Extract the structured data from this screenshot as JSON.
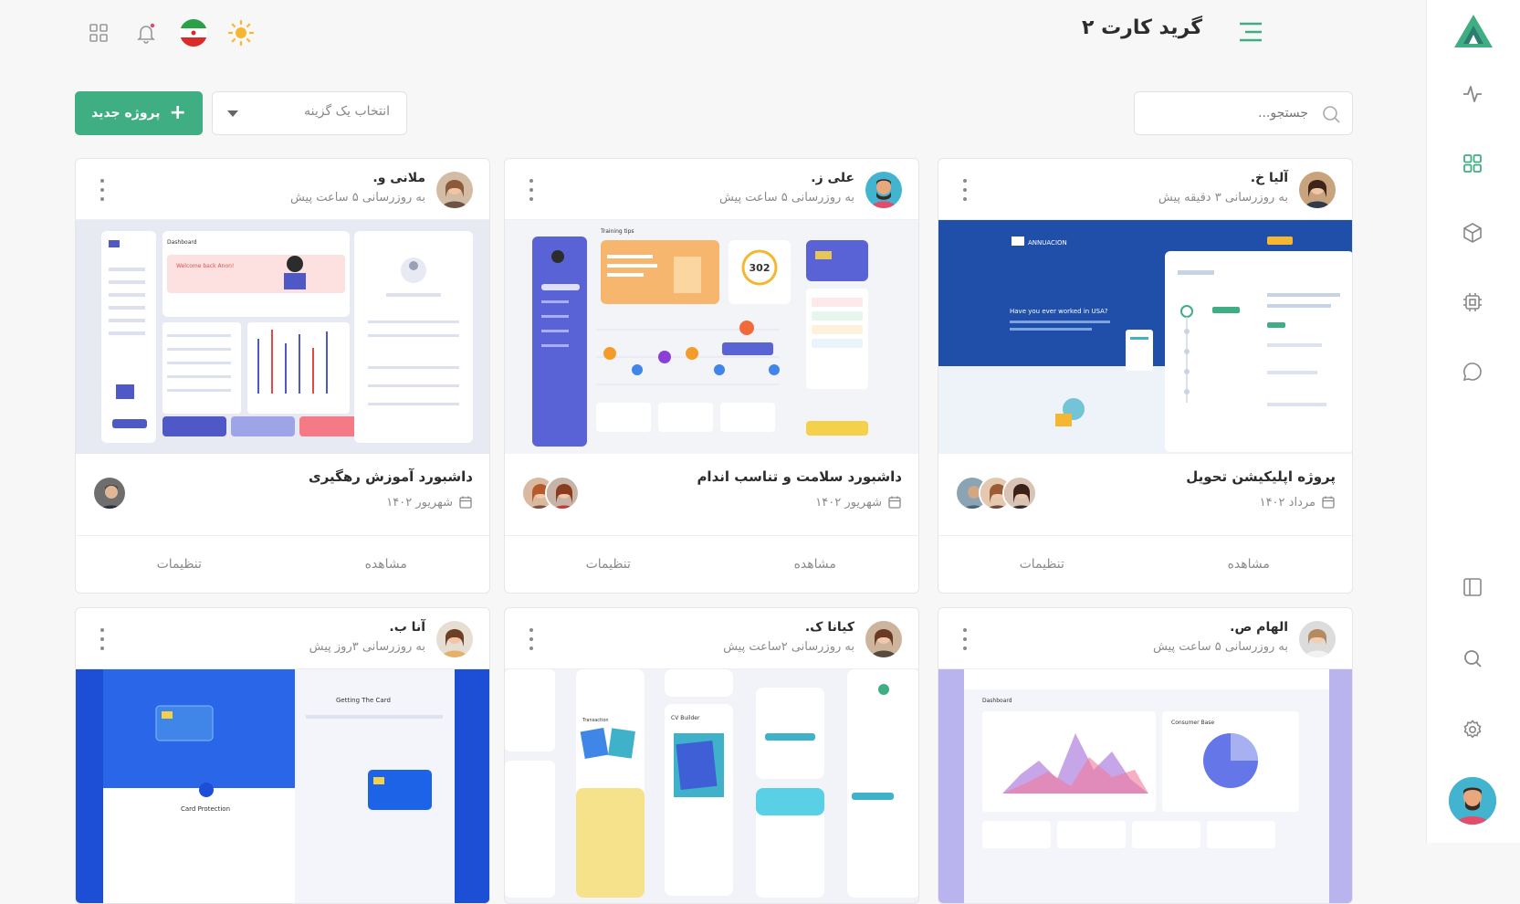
{
  "header": {
    "title": "گرید کارت ۲"
  },
  "toolbar": {
    "search_placeholder": "جستجو...",
    "select_label": "انتخاب یک گزینه",
    "new_project_label": "پروژه جدید"
  },
  "colors": {
    "accent": "#3fae83",
    "sun": "#f5b731",
    "notify_dot": "#e8456b"
  },
  "sidebar": {
    "items": [
      "activity-icon",
      "grid-icon",
      "cube-icon",
      "chip-icon",
      "chat-icon",
      "layout-icon",
      "search-icon",
      "settings-icon"
    ]
  },
  "cards": [
    {
      "user": "آلیا خ.",
      "updated": "به روزرسانی ۳ دقیقه پیش",
      "title": "پروژه اپلیکیشن تحویل",
      "date": "مرداد ۱۴۰۲",
      "view": "مشاهده",
      "settings": "تنظیمات",
      "img_label": "ANNUACION",
      "img_heading": "Have you ever worked in USA?"
    },
    {
      "user": "علی ز.",
      "updated": "به روزرسانی ۵ ساعت پیش",
      "title": "داشبورد سلامت و تناسب اندام",
      "date": "شهریور ۱۴۰۲",
      "view": "مشاهده",
      "settings": "تنظیمات",
      "img_label": "Training tips",
      "img_heading": "302"
    },
    {
      "user": "ملانی و.",
      "updated": "به روزرسانی ۵ ساعت پیش",
      "title": "داشبورد آموزش رهگیری",
      "date": "شهریور ۱۴۰۲",
      "view": "مشاهده",
      "settings": "تنظیمات",
      "img_label": "Dashboard",
      "img_heading": "Welcome back Anon!"
    },
    {
      "user": "الهام ص.",
      "updated": "به روزرسانی ۵ ساعت پیش",
      "img_label": "Dashboard",
      "img_heading": "Consumer Base"
    },
    {
      "user": "کیانا ک.",
      "updated": "به روزرسانی ۲ساعت پیش",
      "img_label": "CV Builder",
      "img_heading": "Transaction"
    },
    {
      "user": "آنا ب.",
      "updated": "به روزرسانی ۳روز پیش",
      "img_label": "Getting The Card",
      "img_heading": "Card Protection"
    }
  ]
}
